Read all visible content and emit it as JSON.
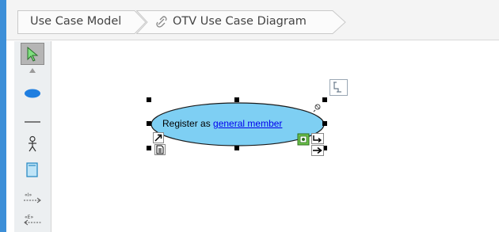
{
  "breadcrumb": {
    "items": [
      {
        "label": "Use Case Model",
        "icon": ""
      },
      {
        "label": "OTV Use Case Diagram",
        "icon": "diagram-link-icon"
      }
    ]
  },
  "toolbar": {
    "tools": [
      {
        "name": "selector-tool-icon"
      },
      {
        "name": "scroll-up-icon"
      },
      {
        "name": "use-case-tool-icon"
      },
      {
        "name": "association-tool-icon"
      },
      {
        "name": "actor-tool-icon"
      },
      {
        "name": "system-boundary-tool-icon"
      },
      {
        "name": "include-tool-icon"
      },
      {
        "name": "extend-tool-icon"
      }
    ]
  },
  "diagram": {
    "use_case": {
      "text_prefix": "Register as ",
      "text_link": "general member",
      "fill_color": "#7ecff3",
      "stroke_color": "#1a1a1a"
    },
    "colors": {
      "link": "#0000ee",
      "accent_strip": "#3d8fd8"
    }
  }
}
